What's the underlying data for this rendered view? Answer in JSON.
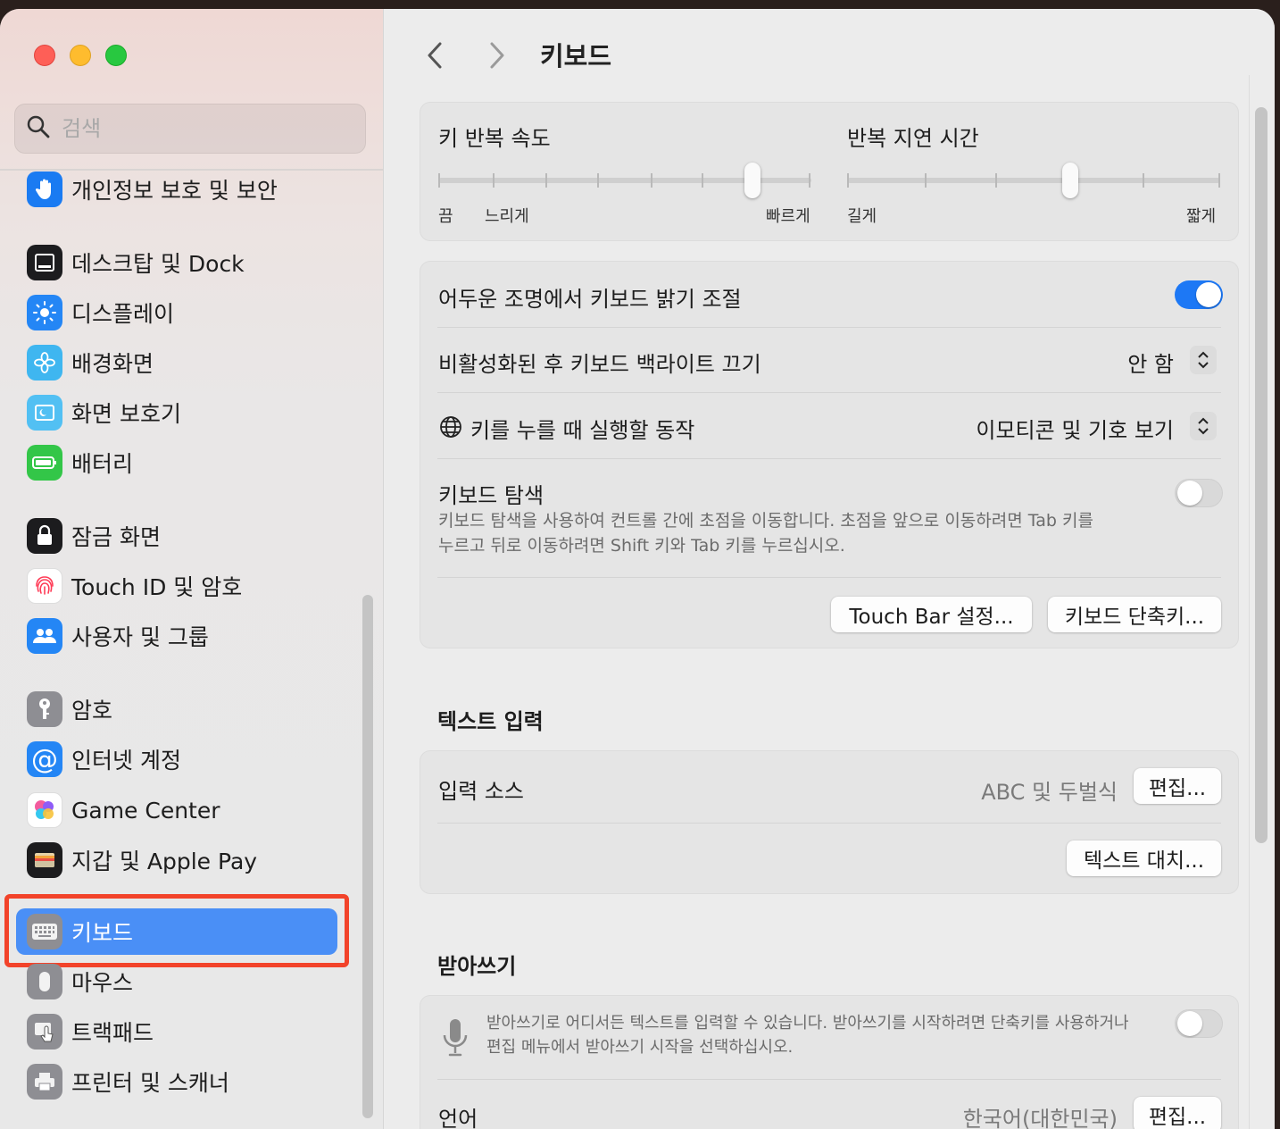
{
  "search": {
    "placeholder": "검색"
  },
  "sidebar": {
    "items": [
      {
        "label": "개인정보 보호 및 보안",
        "icon": "hand-icon",
        "color": "#1a7bf2"
      },
      {
        "label": "데스크탑 및 Dock",
        "icon": "dock-icon",
        "color": "#1c1c1e"
      },
      {
        "label": "디스플레이",
        "icon": "sun-icon",
        "color": "#2486f5"
      },
      {
        "label": "배경화면",
        "icon": "flower-icon",
        "color": "#3fb6f0"
      },
      {
        "label": "화면 보호기",
        "icon": "screensaver-icon",
        "color": "#52c0f3"
      },
      {
        "label": "배터리",
        "icon": "battery-icon",
        "color": "#33c648"
      },
      {
        "label": "잠금 화면",
        "icon": "lock-icon",
        "color": "#1c1c1e"
      },
      {
        "label": "Touch ID 및 암호",
        "icon": "fingerprint-icon",
        "color": "#ffffff"
      },
      {
        "label": "사용자 및 그룹",
        "icon": "users-icon",
        "color": "#2486f5"
      },
      {
        "label": "암호",
        "icon": "key-icon",
        "color": "#8e8e93"
      },
      {
        "label": "인터넷 계정",
        "icon": "at-icon",
        "color": "#2486f5"
      },
      {
        "label": "Game Center",
        "icon": "game-center-icon",
        "color": "#ffffff"
      },
      {
        "label": "지갑 및 Apple Pay",
        "icon": "wallet-icon",
        "color": "#1c1c1e"
      },
      {
        "label": "키보드",
        "icon": "keyboard-icon",
        "color": "#8e8e93"
      },
      {
        "label": "마우스",
        "icon": "mouse-icon",
        "color": "#8e8e93"
      },
      {
        "label": "트랙패드",
        "icon": "trackpad-icon",
        "color": "#8e8e93"
      },
      {
        "label": "프린터 및 스캐너",
        "icon": "printer-icon",
        "color": "#8e8e93"
      }
    ]
  },
  "header": {
    "title": "키보드"
  },
  "key_repeat": {
    "title": "키 반복 속도",
    "min_label": "끔",
    "slow_label": "느리게",
    "max_label": "빠르게",
    "value_fraction": 0.84
  },
  "repeat_delay": {
    "title": "반복 지연 시간",
    "min_label": "길게",
    "max_label": "짧게",
    "value_fraction": 0.6
  },
  "settings": {
    "adjust_brightness": {
      "label": "어두운 조명에서 키보드 밝기 조절",
      "on": true
    },
    "backlight_off": {
      "label": "비활성화된 후 키보드 백라이트 끄기",
      "value": "안 함"
    },
    "globe_key": {
      "label": "키를 누를 때 실행할 동작",
      "value": "이모티콘 및 기호 보기"
    },
    "keyboard_nav": {
      "label": "키보드 탐색",
      "desc_line1": "키보드 탐색을 사용하여 컨트롤 간에 초점을 이동합니다. 초점을 앞으로 이동하려면 Tab 키를",
      "desc_line2": "누르고 뒤로 이동하려면 Shift 키와 Tab 키를 누르십시오.",
      "on": false
    },
    "touchbar_button": "Touch Bar 설정...",
    "shortcuts_button": "키보드 단축키..."
  },
  "text_input": {
    "section_title": "텍스트 입력",
    "input_sources_label": "입력 소스",
    "input_sources_value": "ABC 및 두벌식",
    "edit_button": "편집...",
    "text_replace_button": "텍스트 대치..."
  },
  "dictation": {
    "section_title": "받아쓰기",
    "desc_line1": "받아쓰기로 어디서든 텍스트를 입력할 수 있습니다. 받아쓰기를 시작하려면 단축키를 사용하거나",
    "desc_line2": "편집 메뉴에서 받아쓰기 시작을 선택하십시오.",
    "on": false,
    "language_label": "언어",
    "language_value": "한국어(대한민국)",
    "edit_button": "편집..."
  },
  "colors": {
    "accent": "#1d78f5",
    "selected": "#4a8ff6",
    "highlight": "#f2432a"
  }
}
